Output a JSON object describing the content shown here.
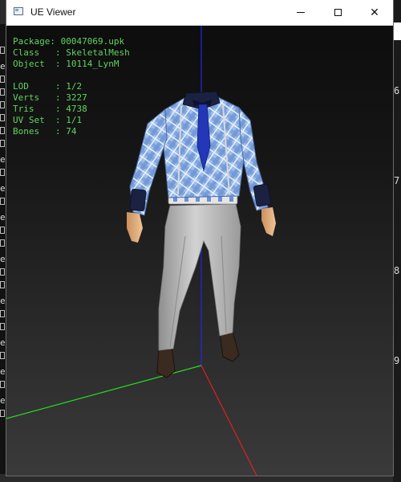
{
  "window": {
    "title": "UE Viewer",
    "minimize_icon": "minimize-icon",
    "maximize_icon": "maximize-icon",
    "close_glyph": "✕"
  },
  "info": {
    "package": "Package: 00047069.upk",
    "class": "Class   : SkeletalMesh",
    "object": "Object  : 10114_LynM",
    "lod": "LOD     : 1/2",
    "verts": "Verts   : 3227",
    "tris": "Tris    : 4738",
    "uvset": "UV Set  : 1/1",
    "bones": "Bones   : 74"
  },
  "background": {
    "right_numbers": [
      "6",
      "7",
      "8",
      "9"
    ],
    "left_letter": "e"
  },
  "colors": {
    "info_text": "#5fd55f",
    "axis_x": "#e02020",
    "axis_y": "#22dd22",
    "axis_z": "#2020e0",
    "shirt": "#8fb3e6",
    "pants": "#b9b9b9"
  }
}
